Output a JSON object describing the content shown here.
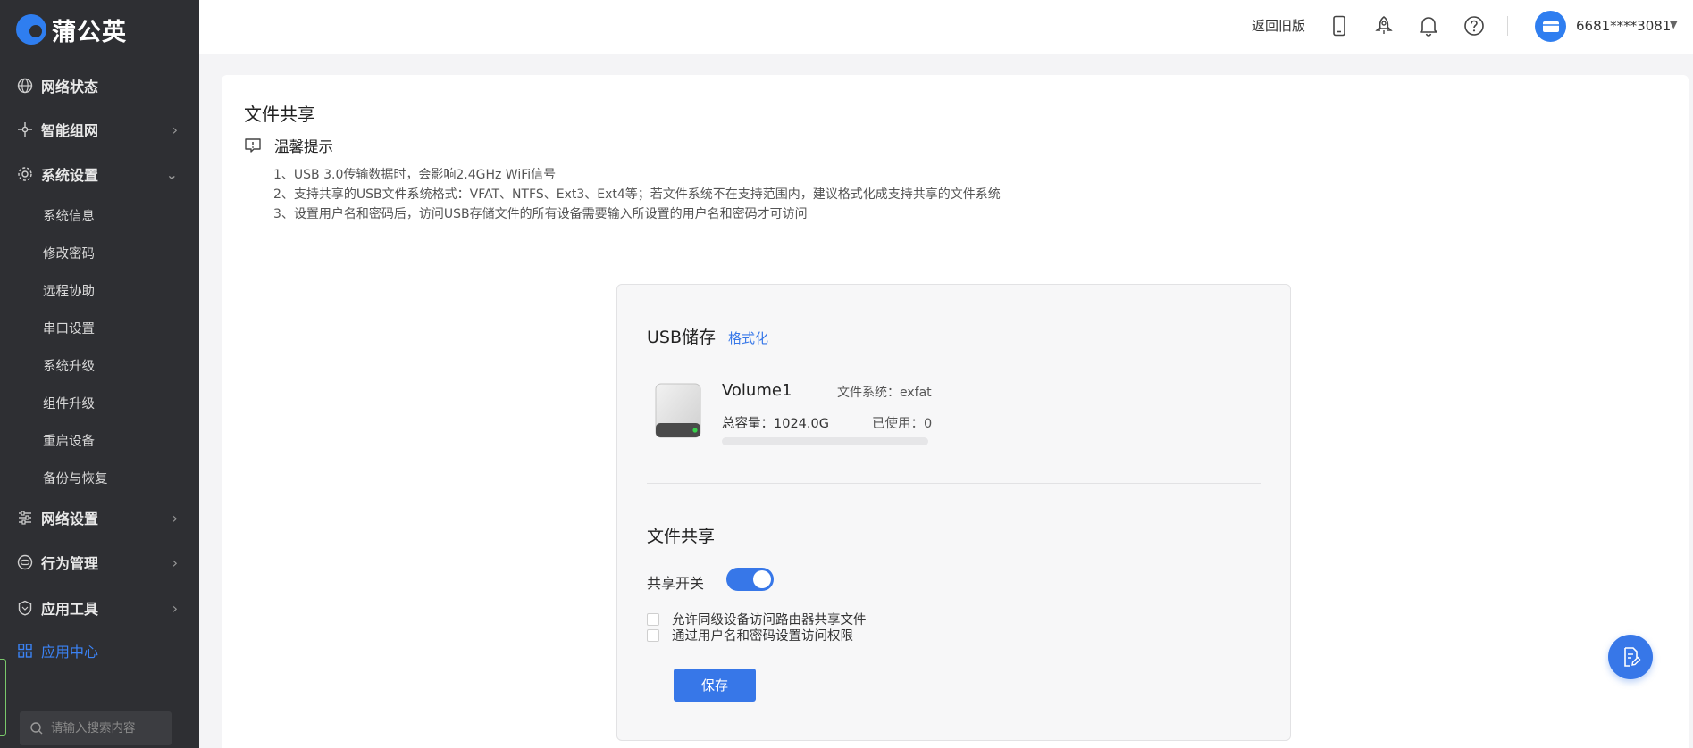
{
  "brand": {
    "name": "蒲公英",
    "accent": "#3777e8"
  },
  "sidebar": {
    "items": [
      {
        "label": "网络状态",
        "icon": "globe-icon",
        "has_arrow": false
      },
      {
        "label": "智能组网",
        "icon": "network-icon",
        "has_arrow": true
      },
      {
        "label": "系统设置",
        "icon": "gear-icon",
        "has_arrow": true,
        "expanded": true,
        "children": [
          "系统信息",
          "修改密码",
          "远程协助",
          "串口设置",
          "系统升级",
          "组件升级",
          "重启设备",
          "备份与恢复"
        ]
      },
      {
        "label": "网络设置",
        "icon": "sliders-icon",
        "has_arrow": true
      },
      {
        "label": "行为管理",
        "icon": "behavior-icon",
        "has_arrow": true
      },
      {
        "label": "应用工具",
        "icon": "shield-icon",
        "has_arrow": true
      },
      {
        "label": "应用中心",
        "icon": "apps-grid-icon",
        "has_arrow": false,
        "active": true
      }
    ],
    "search": {
      "placeholder": "请输入搜索内容"
    }
  },
  "topbar": {
    "back_link": "返回旧版",
    "icons": [
      "phone-icon",
      "rocket-icon",
      "bell-icon",
      "help-icon"
    ],
    "username": "6681****3081"
  },
  "page": {
    "title": "文件共享",
    "tip_title": "温馨提示",
    "tips": [
      "1、USB 3.0传输数据时，会影响2.4GHz WiFi信号",
      "2、支持共享的USB文件系统格式：VFAT、NTFS、Ext3、Ext4等；若文件系统不在支持范围内，建议格式化成支持共享的文件系统",
      "3、设置用户名和密码后，访问USB存储文件的所有设备需要输入所设置的用户名和密码才可访问"
    ]
  },
  "usb": {
    "title": "USB储存",
    "format_link": "格式化",
    "volume_name": "Volume1",
    "filesystem_label": "文件系统：exfat",
    "capacity_label": "总容量：1024.0G",
    "used_label": "已使用：0",
    "used_fraction": 0
  },
  "sharing": {
    "title": "文件共享",
    "switch_label": "共享开关",
    "switch_on": true,
    "options": [
      {
        "label": "允许同级设备访问路由器共享文件",
        "checked": false
      },
      {
        "label": "通过用户名和密码设置访问权限",
        "checked": false
      }
    ],
    "save_label": "保存"
  }
}
